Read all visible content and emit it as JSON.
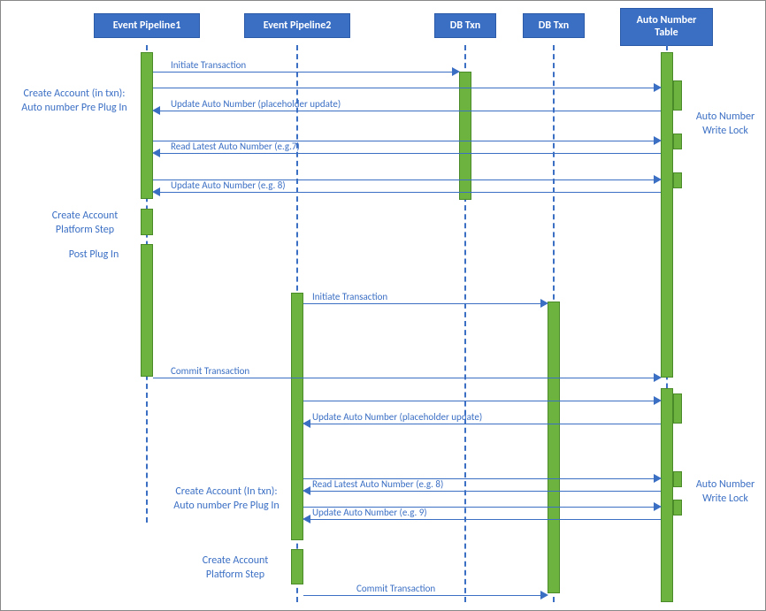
{
  "participants": {
    "p1": "Event Pipeline1",
    "p2": "Event Pipeline2",
    "p3": "DB Txn",
    "p4": "DB Txn",
    "p5": "Auto Number Table"
  },
  "labels": {
    "l_create_pre": "Create Account (in txn): Auto number Pre Plug In",
    "l_platform": "Create Account Platform Step",
    "l_post": "Post Plug In",
    "l_create_pre2": "Create Account (In txn): Auto number Pre Plug In",
    "l_platform2": "Create Account Platform Step",
    "r_lock1": "Auto Number Write Lock",
    "r_lock2": "Auto Number Write Lock"
  },
  "messages": {
    "m1": "Initiate Transaction",
    "m2": "Update Auto Number (placeholder update)",
    "m3": "Read Latest Auto Number (e.g.7)",
    "m4": "Update Auto Number (e.g. 8)",
    "m5": "Initiate Transaction",
    "m6": "Commit Transaction",
    "m7": "Update Auto Number (placeholder update)",
    "m8": "Read Latest Auto Number (e.g. 8)",
    "m9": "Update Auto Number (e.g. 9)",
    "m10": "Commit Transaction"
  },
  "chart_data": {
    "type": "sequence_diagram",
    "participants": [
      "Event Pipeline1",
      "Event Pipeline2",
      "DB Txn",
      "DB Txn",
      "Auto Number Table"
    ],
    "messages": [
      {
        "from": "Event Pipeline1",
        "to": "DB Txn(1)",
        "text": "Initiate Transaction",
        "dir": "right"
      },
      {
        "from": "Auto Number Table",
        "to": "Event Pipeline1",
        "text": "Update Auto Number (placeholder update)",
        "dir": "left"
      },
      {
        "from": "Auto Number Table",
        "to": "Event Pipeline1",
        "text": "Read Latest Auto Number (e.g.7)",
        "dir": "left"
      },
      {
        "from": "Auto Number Table",
        "to": "Event Pipeline1",
        "text": "Update Auto Number (e.g. 8)",
        "dir": "left"
      },
      {
        "from": "Event Pipeline2",
        "to": "DB Txn(2)",
        "text": "Initiate Transaction",
        "dir": "right"
      },
      {
        "from": "Event Pipeline1",
        "to": "Auto Number Table",
        "text": "Commit Transaction",
        "dir": "right"
      },
      {
        "from": "Auto Number Table",
        "to": "Event Pipeline2",
        "text": "Update Auto Number (placeholder update)",
        "dir": "left"
      },
      {
        "from": "Auto Number Table",
        "to": "Event Pipeline2",
        "text": "Read Latest Auto Number (e.g. 8)",
        "dir": "left"
      },
      {
        "from": "Auto Number Table",
        "to": "Event Pipeline2",
        "text": "Update Auto Number (e.g. 9)",
        "dir": "left"
      },
      {
        "from": "Event Pipeline2",
        "to": "DB Txn(2)",
        "text": "Commit Transaction",
        "dir": "right"
      }
    ],
    "left_annotations": [
      "Create Account (in txn): Auto number Pre Plug In",
      "Create Account Platform Step",
      "Post Plug In",
      "Create Account (In txn): Auto number Pre Plug In",
      "Create Account Platform Step"
    ],
    "right_annotations": [
      "Auto Number Write Lock",
      "Auto Number Write Lock"
    ]
  }
}
